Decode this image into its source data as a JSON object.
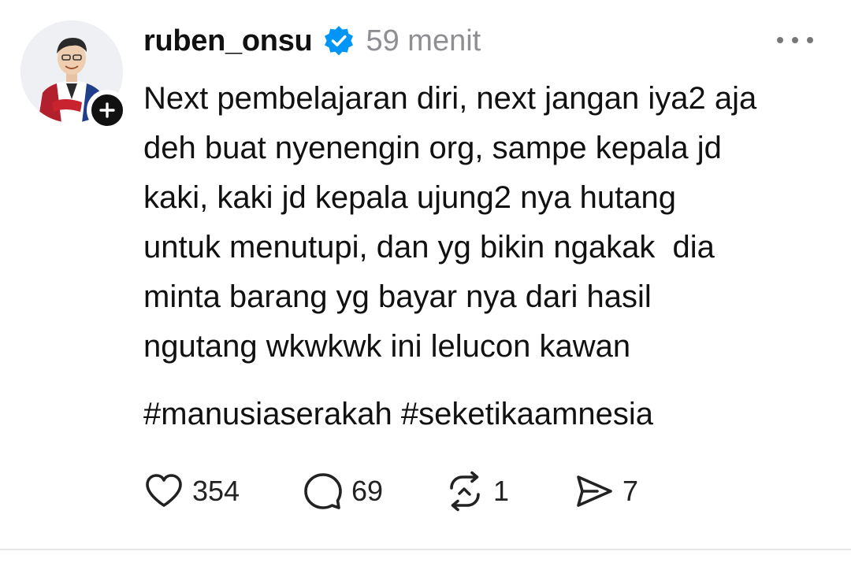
{
  "post": {
    "username": "ruben_onsu",
    "timestamp": "59 menit",
    "body": "Next pembelajaran diri, next jangan iya2 aja\ndeh buat nyenengin org, sampe kepala jd\nkaki, kaki jd kepala ujung2 nya hutang\nuntuk menutupi, dan yg bikin ngakak  dia\nminta barang yg bayar nya dari hasil\nngutang wkwkwk ini lelucon kawan",
    "hashtags": "#manusiaserakah #seketikaamnesia",
    "verified_color": "#0095f6"
  },
  "actions": {
    "likes": "354",
    "comments": "69",
    "reposts": "1",
    "shares": "7"
  },
  "icons": {
    "avatar": "profile-photo",
    "follow": "plus-icon",
    "verified": "verified-badge-icon",
    "more": "more-horizontal-icon",
    "like": "heart-icon",
    "comment": "comment-bubble-icon",
    "repost": "repost-icon",
    "share": "send-icon"
  }
}
